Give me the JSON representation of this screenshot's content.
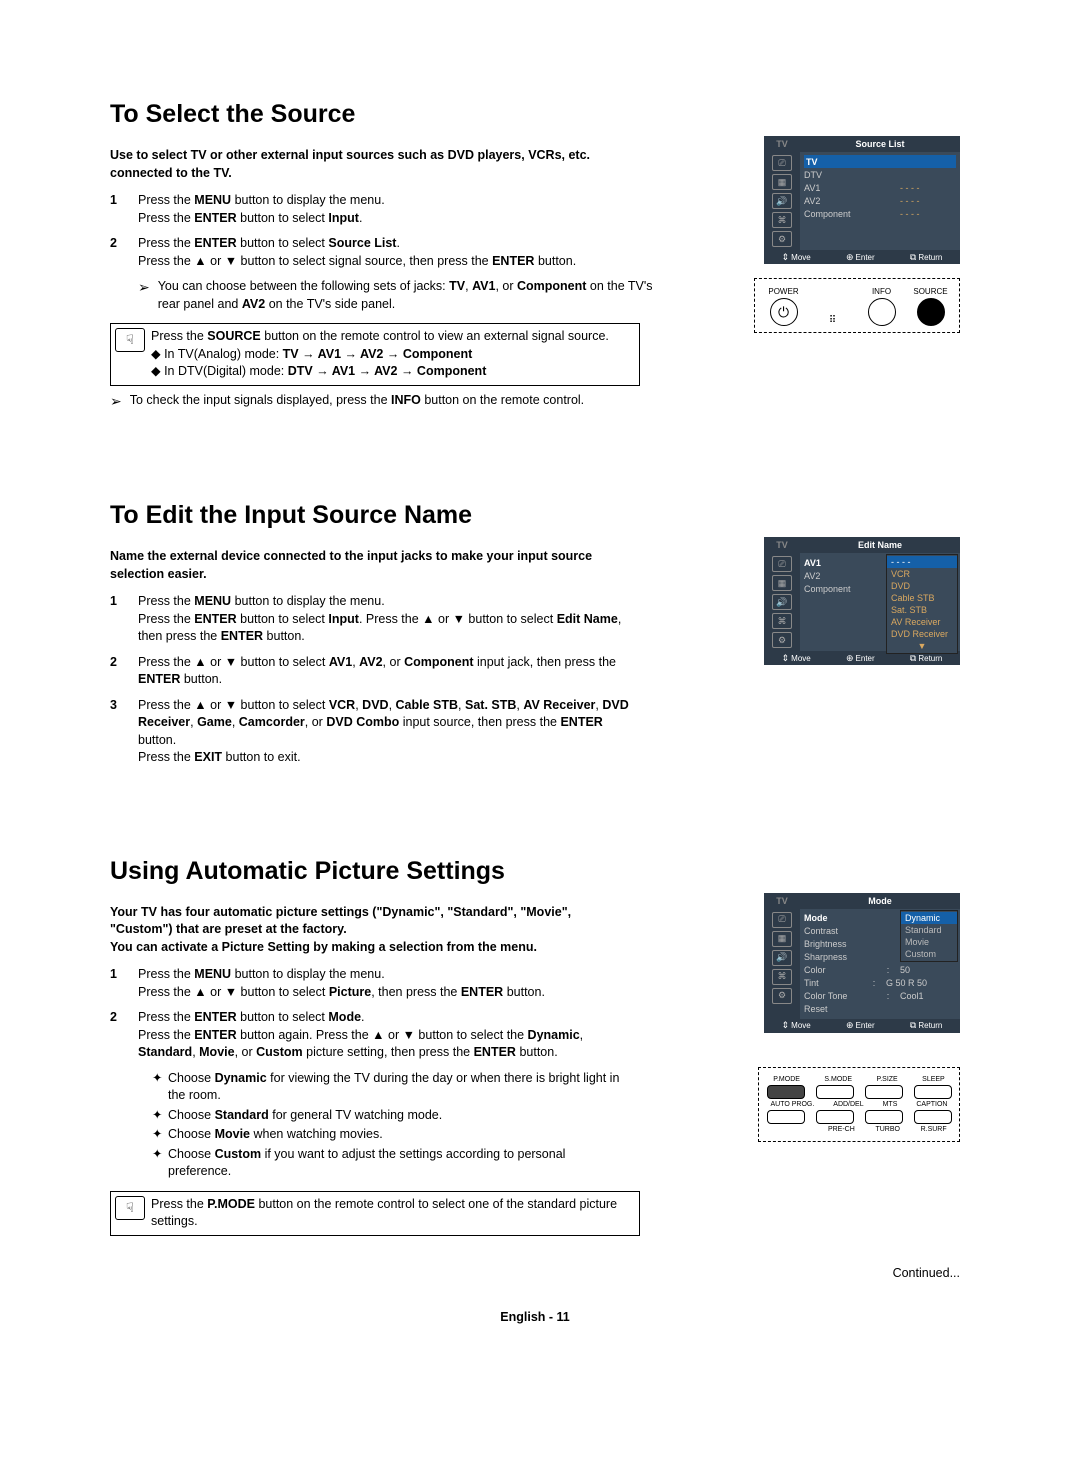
{
  "section1": {
    "title": "To Select the Source",
    "intro": "Use to select TV or other external input sources such as DVD players, VCRs, etc. connected to the TV.",
    "step1_num": "1",
    "step1_html": "Press the <b>MENU</b> button to display the menu.<br>Press the <b>ENTER</b> button to select <b>Input</b>.",
    "step2_num": "2",
    "step2_html": "Press the <b>ENTER</b> button to select <b>Source List</b>.<br>Press the ▲ or ▼ button to select signal source, then press the <b>ENTER</b> button.",
    "note1_html": "You can choose between the following sets of jacks: <b>TV</b>, <b>AV1</b>, or <b>Component</b> on the TV's rear panel and <b>AV2</b> on the TV's side panel.",
    "remote_html": "Press the <b>SOURCE</b> button on the remote control to view an external signal source.<br>◆ In TV(Analog) mode: <b>TV → AV1 → AV2 → Component</b><br>◆ In DTV(Digital) mode: <b>DTV → AV1 → AV2 → Component</b>",
    "note2_html": "To check the input signals displayed, press the <b>INFO</b> button on the remote control.",
    "osd": {
      "tv": "TV",
      "title": "Source List",
      "items": [
        {
          "k": "TV",
          "hl": true
        },
        {
          "k": "DTV"
        },
        {
          "k": "AV1",
          "v": "- - - -"
        },
        {
          "k": "AV2",
          "v": "- - - -"
        },
        {
          "k": "Component",
          "v": "- - - -"
        }
      ],
      "move": "Move",
      "enter": "Enter",
      "return": "Return"
    },
    "remote_ill": {
      "power": "POWER",
      "info": "INFO",
      "source": "SOURCE"
    }
  },
  "section2": {
    "title": "To Edit the Input Source Name",
    "intro": "Name the external device connected to the input jacks to make your input source selection easier.",
    "step1_num": "1",
    "step1_html": "Press the <b>MENU</b> button to display the menu.<br>Press the <b>ENTER</b> button to select <b>Input</b>. Press the ▲ or ▼ button to select <b>Edit Name</b>, then press the <b>ENTER</b> button.",
    "step2_num": "2",
    "step2_html": "Press the ▲ or ▼ button to select <b>AV1</b>, <b>AV2</b>, or <b>Component</b> input jack, then press the <b>ENTER</b> button.",
    "step3_num": "3",
    "step3_html": "Press the ▲ or ▼ button to select <b>VCR</b>, <b>DVD</b>, <b>Cable STB</b>, <b>Sat. STB</b>, <b>AV Receiver</b>, <b>DVD Receiver</b>, <b>Game</b>, <b>Camcorder</b>, or <b>DVD Combo</b> input source, then press the <b>ENTER</b> button.<br>Press the <b>EXIT</b> button to exit.",
    "osd": {
      "tv": "TV",
      "title": "Edit Name",
      "items": [
        {
          "k": "AV1",
          "c": ":",
          "hl": true
        },
        {
          "k": "AV2",
          "c": ":"
        },
        {
          "k": "Component",
          "c": ":"
        }
      ],
      "submenu": [
        "- - - -",
        "VCR",
        "DVD",
        "Cable STB",
        "Sat. STB",
        "AV Receiver",
        "DVD Receiver",
        "▼"
      ],
      "move": "Move",
      "enter": "Enter",
      "return": "Return"
    }
  },
  "section3": {
    "title": "Using Automatic Picture Settings",
    "intro": "Your TV has four automatic picture settings (\"Dynamic\", \"Standard\", \"Movie\", \"Custom\") that are preset at the factory.\nYou can activate a Picture Setting by making a selection from the menu.",
    "step1_num": "1",
    "step1_html": "Press the <b>MENU</b> button to display the menu.<br>Press the ▲ or ▼ button to select <b>Picture</b>, then press the <b>ENTER</b> button.",
    "step2_num": "2",
    "step2_html": "Press the <b>ENTER</b> button to select <b>Mode</b>.<br>Press the <b>ENTER</b> button again. Press the ▲ or ▼ button to select the <b>Dynamic</b>, <b>Standard</b>, <b>Movie</b>, or <b>Custom</b> picture setting, then press the <b>ENTER</b> button.",
    "bullets": [
      "Choose <b>Dynamic</b> for viewing the TV during the day or when there is bright light in the room.",
      "Choose <b>Standard</b> for general TV watching mode.",
      "Choose <b>Movie</b> when watching movies.",
      "Choose <b>Custom</b> if you want to adjust the settings according to personal preference."
    ],
    "remote_html": "Press the <b>P.MODE</b> button on the remote control to select one of the standard picture settings.",
    "osd": {
      "tv": "TV",
      "title": "Mode",
      "items": [
        {
          "k": "Mode",
          "c": ":",
          "hl": true
        },
        {
          "k": "Contrast",
          "c": ":"
        },
        {
          "k": "Brightness",
          "c": ":"
        },
        {
          "k": "Sharpness",
          "c": ":"
        },
        {
          "k": "Color",
          "c": ":",
          "v": "50"
        },
        {
          "k": "Tint",
          "c": ":",
          "v": "G 50    R 50"
        },
        {
          "k": "Color Tone",
          "c": ":",
          "v": "Cool1"
        },
        {
          "k": "Reset"
        }
      ],
      "submenu": [
        "Dynamic",
        "Standard",
        "Movie",
        "Custom"
      ],
      "move": "Move",
      "enter": "Enter",
      "return": "Return"
    },
    "remote_buttons": {
      "r1": [
        "P.MODE",
        "S.MODE",
        "P.SIZE",
        "SLEEP"
      ],
      "r2": [
        "AUTO PROG.",
        "ADD/DEL",
        "MTS",
        "CAPTION"
      ],
      "r3": [
        "PRE-CH",
        "TURBO",
        "R.SURF"
      ]
    }
  },
  "continued": "Continued...",
  "footer": "English - 11"
}
